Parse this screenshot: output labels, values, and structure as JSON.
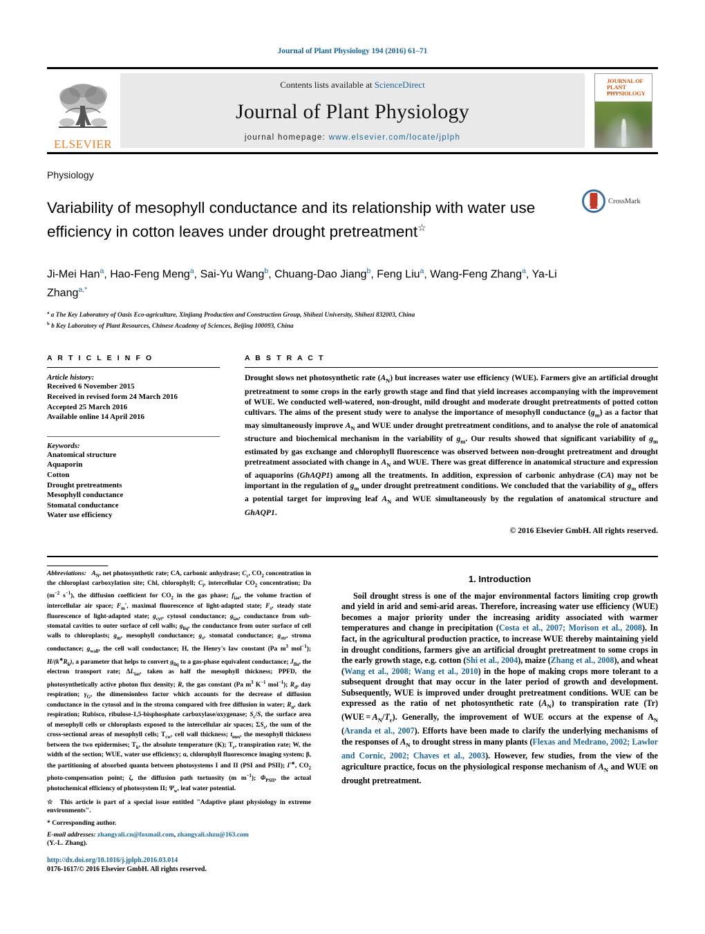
{
  "running_head": "Journal of Plant Physiology 194 (2016) 61–71",
  "masthead": {
    "contents_prefix": "Contents lists available at ",
    "sciencedirect": "ScienceDirect",
    "journal_title": "Journal of Plant Physiology",
    "homepage_prefix": "journal homepage: ",
    "homepage_url": "www.elsevier.com/locate/jplph",
    "publisher": "ELSEVIER",
    "cover_title_line1": "JOURNAL OF",
    "cover_title_line2": "PLANT PHYSIOLOGY",
    "link_color": "#1a6496",
    "elsevier_orange": "#f07d20"
  },
  "article": {
    "subject": "Physiology",
    "title": "Variability of mesophyll conductance and its relationship with water use efficiency in cotton leaves under drought pretreatment",
    "title_marker": "☆",
    "crossmark_label": "CrossMark",
    "authors_html": "Ji-Mei Han<sup>a</sup>, Hao-Feng Meng<sup>a</sup>, Sai-Yu Wang<sup>b</sup>, Chuang-Dao Jiang<sup>b</sup>, Feng Liu<sup>a</sup>, Wang-Feng Zhang<sup>a</sup>, Ya-Li Zhang<sup>a,</sup><sup>*</sup>",
    "affiliations": [
      "a The Key Laboratory of Oasis Eco-agriculture, Xinjiang Production and Construction Group, Shihezi University, Shihezi 832003, China",
      "b Key Laboratory of Plant Resources, Chinese Academy of Sciences, Beijing 100093, China"
    ]
  },
  "article_info": {
    "heading": "A R T I C L E   I N F O",
    "history_title": "Article history:",
    "history": [
      "Received 6 November 2015",
      "Received in revised form 24 March 2016",
      "Accepted 25 March 2016",
      "Available online 14 April 2016"
    ],
    "keywords_title": "Keywords:",
    "keywords": [
      "Anatomical structure",
      "Aquaporin",
      "Cotton",
      "Drought pretreatments",
      "Mesophyll conductance",
      "Stomatal conductance",
      "Water use efficiency"
    ]
  },
  "abstract": {
    "heading": "A B S T R A C T",
    "text_html": "Drought slows net photosynthetic rate (<i>A</i><sub>N</sub>) but increases water use efficiency (WUE). Farmers give an artificial drought pretreatment to some crops in the early growth stage and find that yield increases accompanying with the improvement of WUE. We conducted well-watered, non-drought, mild drought and moderate drought pretreatments of potted cotton cultivars. The aims of the present study were to analyse the importance of mesophyll conductance (<i>g</i><sub>m</sub>) as a factor that may simultaneously improve <i>A</i><sub>N</sub> and WUE under drought pretreatment conditions, and to analyse the role of anatomical structure and biochemical mechanism in the variability of <i>g</i><sub>m</sub>. Our results showed that significant variability of <i>g</i><sub>m</sub> estimated by gas exchange and chlorophyll fluorescence was observed between non-drought pretreatment and drought pretreatment associated with change in <i>A</i><sub>N</sub> and WUE. There was great difference in anatomical structure and expression of aquaporins (<i>GhAQP1</i>) among all the treatments. In addition, expression of carbonic anhydrase (<i>CA</i>) may not be important in the regulation of <i>g</i><sub>m</sub> under drought pretreatment conditions. We concluded that the variability of <i>g</i><sub>m</sub> offers a potential target for improving leaf <i>A</i><sub>N</sub> and WUE simultaneously by the regulation of anatomical structure and <i>GhAQP1</i>.",
    "copyright": "© 2016 Elsevier GmbH. All rights reserved."
  },
  "footnotes": {
    "abbreviations_html": "<i>Abbreviations:</i>&nbsp;&nbsp; <i>A</i><sub>N</sub>, net photosynthetic rate; CA, carbonic anhydrase; <i>C</i><sub>c</sub>, CO<sub>2</sub> concentration in the chloroplast carboxylation site; Chl, chlorophyll; <i>C</i><sub>i</sub>, intercellular CO<sub>2</sub> concentration; Da (m<sup>−2</sup> s<sup>−1</sup>), the diffusion coefficient for CO<sub>2</sub> in the gas phase; <i>f</i><sub>ias</sub>, the volume fraction of intercellular air space; <i>F</i><sub>m</sub>′, maximal fluorescence of light-adapted state; <i>F</i><sub>s</sub>, steady state fluorescence of light-adapted state; <i>g</i><sub>cyt</sub>, cytosol conductance; <i>g</i><sub>ias</sub>, conductance from sub-stomatal cavities to outer surface of cell walls; <i>g</i><sub>liq</sub>, the conductance from outer surface of cell walls to chloroplasts; <i>g</i><sub>m</sub>, mesophyll conductance; <i>g</i><sub>s</sub>, stomatal conductance; <i>g</i><sub>str</sub>, stroma conductance; <i>g</i><sub>wall</sub>, the cell wall conductance; H, the Henry's law constant (Pa m<sup>3</sup> mol<sup>−1</sup>); <i>H/(k</i><sup>∗</sup><i>R</i><sub>k</sub><i>)</i>, a parameter that helps to convert <i>g</i><sub>liq</sub> to a gas-phase equivalent conductance; <i>J</i><sub>flu</sub>, the electron transport rate; Δ<i>L</i><sub>ias</sub>, taken as half the mesophyll thickness; PPFD, the photosynthetically active photon flux density; <i>R</i>, the gas constant (Pa m<sup>3</sup> K<sup>−1</sup> mol<sup>−1</sup>); <i>R</i><sub>d</sub>, day respiration; <i>γ</i><sub>G</sub>, the dimensionless factor which accounts for the decrease of diffusion conductance in the cytosol and in the stroma compared with free diffusion in water; <i>R</i><sub>n</sub>, dark respiration; Rubisco, ribulose-1,5-bisphosphate carboxylase/oxygenase; <i>S</i><sub>c</sub>/<i>S</i>, the surface area of mesophyll cells or chloroplasts exposed to the intercellular air spaces; Σ<i>S</i><sub>s</sub>, the sum of the cross-sectional areas of mesophyll cells; T<sub>cw</sub>, cell wall thickness; <i>t</i><sub>mes</sub>, the mesophyll thickness between the two epidermises; T<sub>k</sub>, the absolute temperature (K); T<sub>r</sub>, transpiration rate; W, the width of the section; WUE, water use efficiency; α, chlorophyll fluorescence imaging system; β, the partitioning of absorbed quanta between photosystems I and II (PSI and PSII); <i>Γ</i><sup>∗</sup>, CO<sub>2</sub> photo-compensation point; ζ, the diffusion path tortuosity (m m<sup>−1</sup>); <i>Φ</i><sub>PSII</sub>, the actual photochemical efficiency of photosystem II; <i>Ψ</i><sub>w</sub>, leaf water potential.",
    "special_issue_html": "☆&nbsp; This article is part of a special issue entitled \"Adaptive plant physiology in extreme environments\".",
    "corresponding_html": "*  Corresponding author.",
    "email_label": "E-mail addresses:",
    "email1": "zhangyali.cn@foxmail.com",
    "email2": "zhangyali.shzu@163.com",
    "email_suffix": "(Y.-L. Zhang).",
    "doi": "http://dx.doi.org/10.1016/j.jplph.2016.03.014",
    "issn_line": "0176-1617/© 2016 Elsevier GmbH. All rights reserved."
  },
  "introduction": {
    "number_title": "1.  Introduction",
    "paragraph_html": "Soil drought stress is one of the major environmental factors limiting crop growth and yield in arid and semi-arid areas. Therefore, increasing water use efficiency (WUE) becomes a major priority under the increasing aridity associated with warmer temperatures and change in precipitation (<span class=\"cite\">Costa et al., 2007; Morison et al., 2008</span>). In fact, in the agricultural production practice, to increase WUE thereby maintaining yield in drought conditions, farmers give an artificial drought pretreatment to some crops in the early growth stage, e.g. cotton (<span class=\"cite\">Shi et al., 2004</span>), maize (<span class=\"cite\">Zhang et al., 2008</span>), and wheat (<span class=\"cite\">Wang et al., 2008; Wang et al., 2010</span>) in the hope of making crops more tolerant to a subsequent drought that may occur in the later period of growth and development. Subsequently, WUE is improved under drought pretreatment conditions. WUE can be expressed as the ratio of net photosynthetic rate (<i>A</i><sub>N</sub>) to transpiration rate (Tr) (WUE&#8239;=&#8239;<i>A</i><sub>N</sub>/<i>T</i><sub>r</sub>). Generally, the improvement of WUE occurs at the expense of A<sub>N</sub> (<span class=\"cite\">Aranda et al., 2007</span>). Efforts have been made to clarify the underlying mechanisms of the responses of <i>A</i><sub>N</sub> to drought stress in many plants (<span class=\"cite\">Flexas and Medrano, 2002; Lawlor and Cornic, 2002; Chaves et al., 2003</span>). However, few studies, from the view of the agriculture practice, focus on the physiological response mechanism of <i>A</i><sub>N</sub> and WUE on drought pretreatment."
  }
}
